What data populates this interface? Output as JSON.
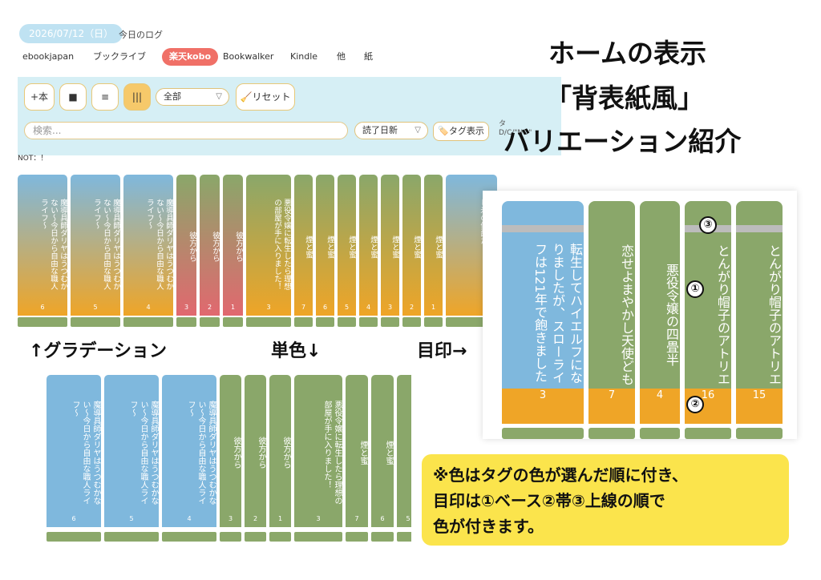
{
  "header": {
    "date": "2026/07/12（日）",
    "log_label": "今日のログ",
    "stores": [
      "ebookjapan",
      "ブックライブ",
      "楽天kobo",
      "Bookwalker",
      "Kindle",
      "他",
      "紙"
    ],
    "selected_store": "楽天kobo"
  },
  "toolbar": {
    "add_label": "+本",
    "view_square": "■",
    "view_list": "≡",
    "view_spine": "|||",
    "filter_value": "全部",
    "reset_label": "🧹リセット",
    "search_placeholder": "検索...",
    "sort_value": "読了日新",
    "tag_label": "🏷️タグ表示",
    "tag_cut_line1": "タ",
    "tag_cut_line2": "D/C/\"NO\"",
    "not_label": "NOT：！"
  },
  "title": {
    "line1": "ホームの表示",
    "line2": "「背表紙風」",
    "line3": "バリエーション紹介"
  },
  "labels": {
    "gradation": "↑グラデーション",
    "single": "単色↓",
    "mark": "目印→"
  },
  "shelf_top": [
    {
      "title": "魔導具師ダリヤはうつむかない〜今日から自由な職人ライフ〜",
      "num": "6",
      "style": "grad-blue"
    },
    {
      "title": "魔導具師ダリヤはうつむかない〜今日から自由な職人ライフ〜",
      "num": "5",
      "style": "grad-blue"
    },
    {
      "title": "魔導具師ダリヤはうつむかない〜今日から自由な職人ライフ〜",
      "num": "4",
      "style": "grad-blue"
    },
    {
      "title": "彼方から",
      "num": "3",
      "style": "grad-red"
    },
    {
      "title": "彼方から",
      "num": "2",
      "style": "grad-red"
    },
    {
      "title": "彼方から",
      "num": "1",
      "style": "grad-red"
    },
    {
      "title": "悪役令嬢に転生したら理想の部屋が手に入りました！",
      "num": "3",
      "style": "grad-green"
    },
    {
      "title": "煙と蜜",
      "num": "7",
      "style": "grad-green"
    },
    {
      "title": "煙と蜜",
      "num": "6",
      "style": "grad-green"
    },
    {
      "title": "煙と蜜",
      "num": "5",
      "style": "grad-green"
    },
    {
      "title": "煙と蜜",
      "num": "4",
      "style": "grad-green"
    },
    {
      "title": "煙と蜜",
      "num": "3",
      "style": "grad-green"
    },
    {
      "title": "煙と蜜",
      "num": "2",
      "style": "grad-green"
    },
    {
      "title": "煙と蜜",
      "num": "1",
      "style": "grad-green"
    },
    {
      "title": "ていたら様に溺愛されてまし氷の侯爵た？",
      "num": "",
      "style": "grad-blue"
    }
  ],
  "shelf_bottom": [
    {
      "title": "魔導具師ダリヤはうつむかない〜今日から自由な職人ライフ〜",
      "num": "6",
      "style": "blue"
    },
    {
      "title": "魔導具師ダリヤはうつむかない〜今日から自由な職人ライフ〜",
      "num": "5",
      "style": "blue"
    },
    {
      "title": "魔導具師ダリヤはうつむかない〜今日から自由な職人ライフ〜",
      "num": "4",
      "style": "blue"
    },
    {
      "title": "彼方から",
      "num": "3",
      "style": "green"
    },
    {
      "title": "彼方から",
      "num": "2",
      "style": "green"
    },
    {
      "title": "彼方から",
      "num": "1",
      "style": "green"
    },
    {
      "title": "悪役令嬢に転生したら理想の部屋が手に入りました！",
      "num": "3",
      "style": "green"
    },
    {
      "title": "煙と蜜",
      "num": "7",
      "style": "green"
    },
    {
      "title": "煙と蜜",
      "num": "6",
      "style": "green"
    },
    {
      "title": "煙と蜜",
      "num": "5",
      "style": "green"
    }
  ],
  "zoom_books": [
    {
      "title": "転生してハイエルフになりましたが、スローライフは121年で飽きました",
      "num": "3",
      "style": "blue"
    },
    {
      "title": "恋せよまやかし天使ども",
      "num": "7",
      "style": "green"
    },
    {
      "title": "悪役令嬢の四畳半",
      "num": "4",
      "style": "green"
    },
    {
      "title": "とんがり帽子のアトリエ",
      "num": "16",
      "style": "green",
      "topline": true
    },
    {
      "title": "とんがり帽子のアトリエ",
      "num": "15",
      "style": "green",
      "topline": true
    }
  ],
  "zoom_marks": [
    "③",
    "①",
    "②"
  ],
  "note": {
    "line1": "※色はタグの色が選んだ順に付き、",
    "line2": "目印は①ベース②帯③上線の順で",
    "line3": "色が付きます。"
  },
  "colors": {
    "blue": "#7fb8dd",
    "green": "#8aa76a",
    "orange": "#efa527",
    "red": "#e1686f",
    "accent": "#f07067",
    "note_bg": "#fbe44c"
  }
}
